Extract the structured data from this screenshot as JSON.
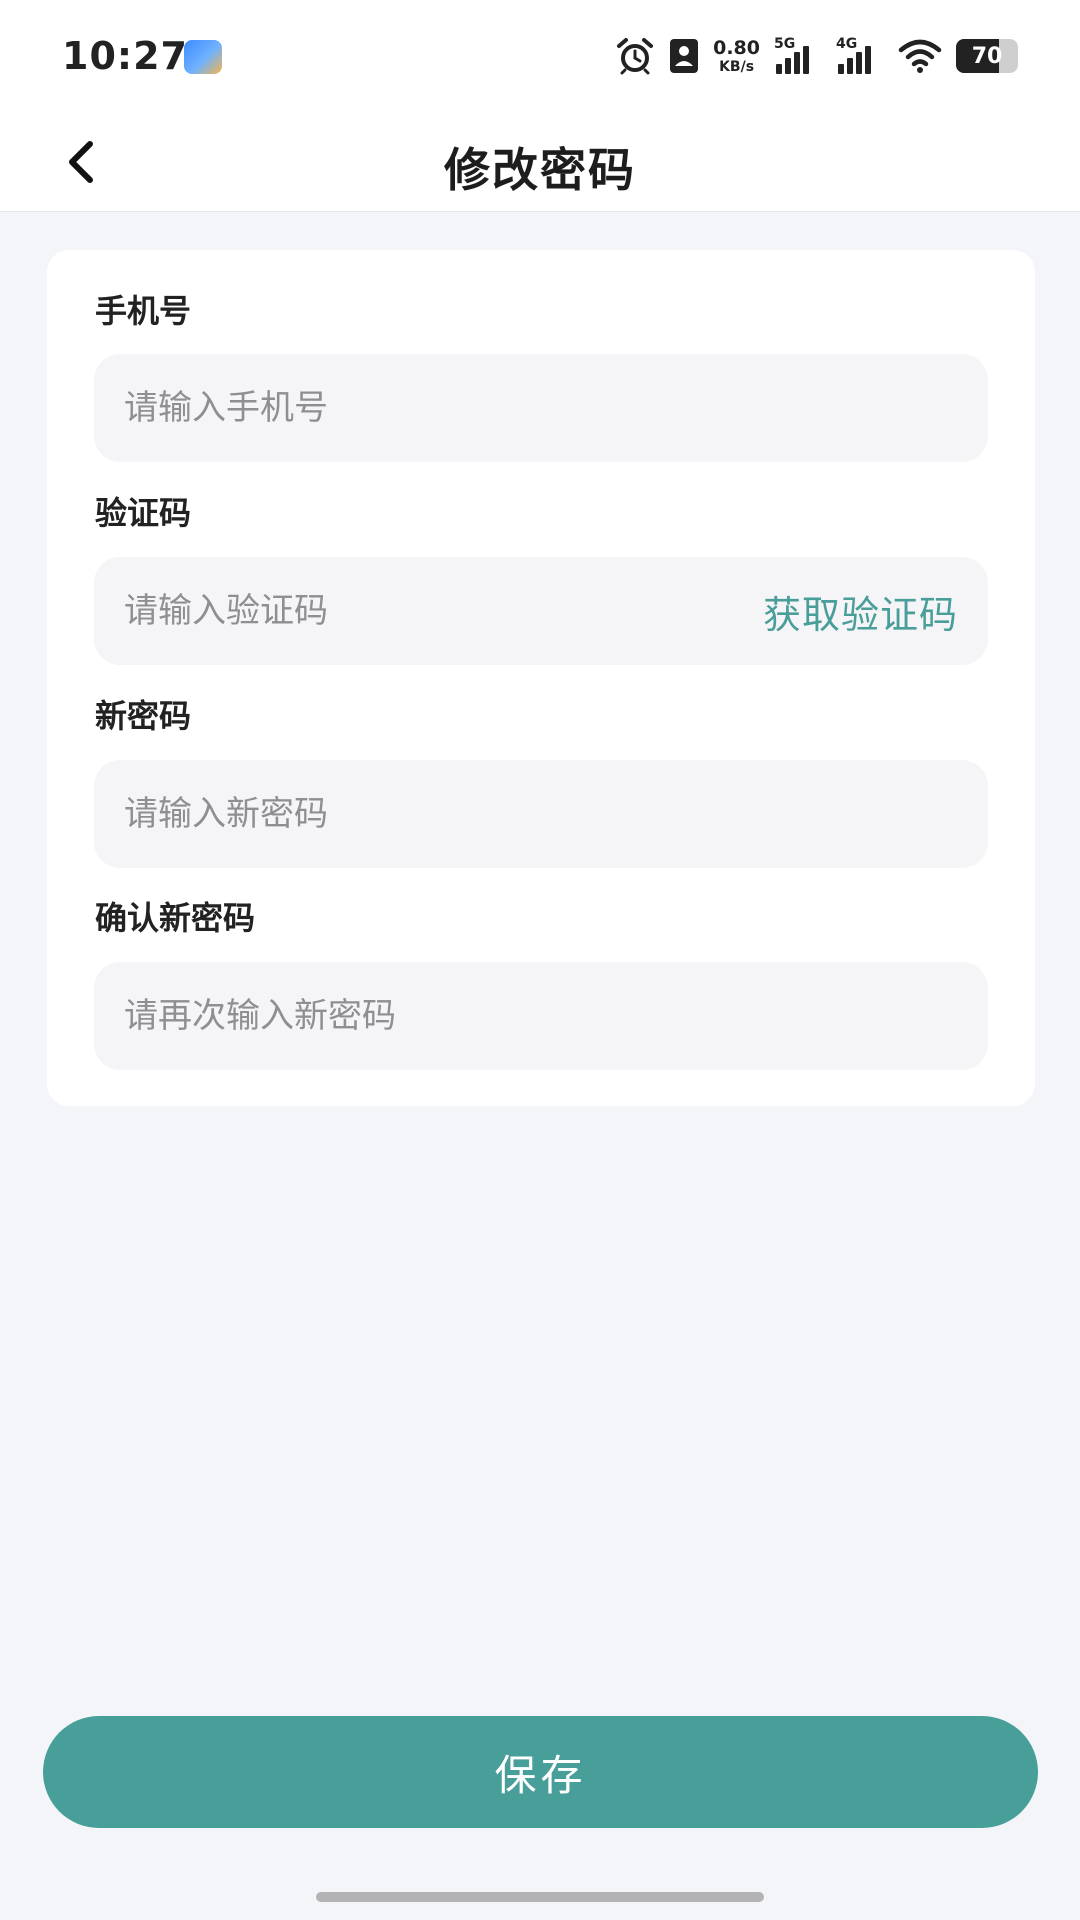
{
  "status_bar": {
    "time": "10:27",
    "net_speed_value": "0.80",
    "net_speed_unit": "KB/s",
    "signal_1_label": "5G",
    "signal_2_label": "4G",
    "battery_level": "70",
    "icons": [
      "alarm-icon",
      "contact-card-icon",
      "signal-5g-icon",
      "signal-4g-icon",
      "wifi-icon",
      "battery-icon"
    ]
  },
  "header": {
    "title": "修改密码",
    "back_icon": "chevron-left-icon"
  },
  "form": {
    "phone": {
      "label": "手机号",
      "placeholder": "请输入手机号",
      "value": ""
    },
    "code": {
      "label": "验证码",
      "placeholder": "请输入验证码",
      "value": "",
      "action": "获取验证码"
    },
    "new_password": {
      "label": "新密码",
      "placeholder": "请输入新密码",
      "value": ""
    },
    "confirm_password": {
      "label": "确认新密码",
      "placeholder": "请再次输入新密码",
      "value": ""
    }
  },
  "save_button": {
    "label": "保存"
  },
  "colors": {
    "accent": "#489e99",
    "link": "#4a9e99",
    "background": "#f4f5f8",
    "card": "#ffffff",
    "input_bg": "#f5f5f7"
  }
}
